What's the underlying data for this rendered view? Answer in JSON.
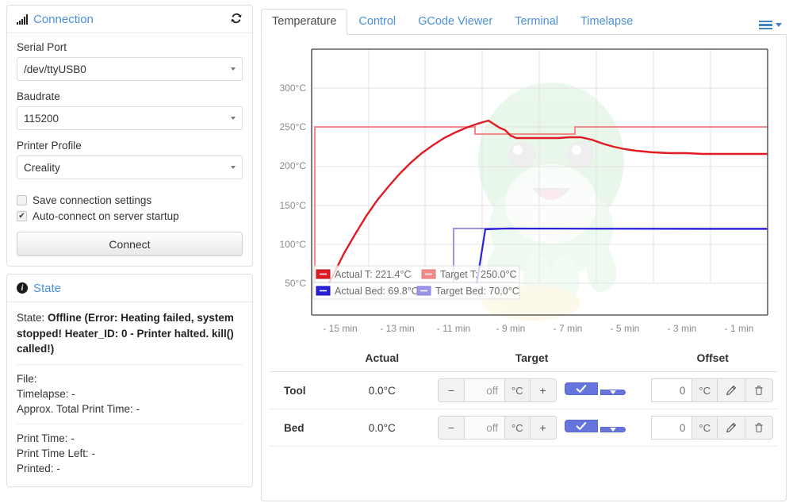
{
  "sidebar": {
    "connection": {
      "icon": "signal-bars-icon",
      "title": "Connection",
      "refresh_icon": "refresh-icon",
      "serial_port_label": "Serial Port",
      "serial_port_value": "/dev/ttyUSB0",
      "baudrate_label": "Baudrate",
      "baudrate_value": "115200",
      "printer_profile_label": "Printer Profile",
      "printer_profile_value": "Creality",
      "save_settings_label": "Save connection settings",
      "save_settings_checked": false,
      "autoconnect_label": "Auto-connect on server startup",
      "autoconnect_checked": true,
      "connect_button": "Connect"
    },
    "state": {
      "icon": "info-icon",
      "title": "State",
      "state_prefix": "State:",
      "state_value": "Offline (Error: Heating failed, system stopped! Heater_ID: 0 - Printer halted. kill() called!)",
      "file_line": "File:",
      "timelapse_line": "Timelapse: -",
      "approx_total_line": "Approx. Total Print Time: -",
      "print_time_line": "Print Time: -",
      "print_time_left_line": "Print Time Left: -",
      "printed_line": "Printed: -"
    }
  },
  "main": {
    "tabs": [
      {
        "label": "Temperature",
        "active": true
      },
      {
        "label": "Control",
        "active": false
      },
      {
        "label": "GCode Viewer",
        "active": false
      },
      {
        "label": "Terminal",
        "active": false
      },
      {
        "label": "Timelapse",
        "active": false
      }
    ],
    "menu_icon": "hamburger-menu-icon",
    "table": {
      "headers": [
        "",
        "Actual",
        "Target",
        "Offset"
      ],
      "rows": [
        {
          "name": "Tool",
          "actual": "0.0°C",
          "target_minus": "−",
          "target_value": "off",
          "target_unit": "°C",
          "target_plus": "+",
          "confirm_icon": "check-icon",
          "dropdown_icon": "caret-down-icon",
          "offset_value": "0",
          "offset_unit": "°C",
          "edit_icon": "pencil-icon",
          "delete_icon": "trash-icon"
        },
        {
          "name": "Bed",
          "actual": "0.0°C",
          "target_minus": "−",
          "target_value": "off",
          "target_unit": "°C",
          "target_plus": "+",
          "confirm_icon": "check-icon",
          "dropdown_icon": "caret-down-icon",
          "offset_value": "0",
          "offset_unit": "°C",
          "edit_icon": "pencil-icon",
          "delete_icon": "trash-icon"
        }
      ]
    }
  },
  "colors": {
    "actual_tool": "#e01b24",
    "target_tool": "#f58a8a",
    "actual_bed": "#2a21d8",
    "target_bed": "#9a95e8",
    "accent_blue": "#4a90d9",
    "primary_button": "#6674dd"
  },
  "chart_data": {
    "type": "line",
    "title": "",
    "xlabel": "",
    "ylabel": "",
    "xlim": [
      -16,
      0
    ],
    "ylim": [
      0,
      310
    ],
    "yticks": [
      50,
      100,
      150,
      200,
      250,
      300
    ],
    "ytick_labels": [
      "50°C",
      "100°C",
      "150°C",
      "200°C",
      "250°C",
      "300°C"
    ],
    "xticks": [
      -15,
      -13,
      -11,
      -9,
      -7,
      -5,
      -3,
      -1
    ],
    "xtick_labels": [
      "- 15 min",
      "- 13 min",
      "- 11 min",
      "- 9 min",
      "- 7 min",
      "- 5 min",
      "- 3 min",
      "- 1 min"
    ],
    "grid": true,
    "legend_position": "inside-bottom-left",
    "legend": [
      {
        "label": "Actual T: 221.4°C",
        "color": "#e01b24"
      },
      {
        "label": "Target T: 250.0°C",
        "color": "#f58a8a"
      },
      {
        "label": "Actual Bed: 69.8°C",
        "color": "#2a21d8"
      },
      {
        "label": "Target Bed: 70.0°C",
        "color": "#9a95e8"
      }
    ],
    "series": [
      {
        "name": "Actual T",
        "color": "#e01b24",
        "x": [
          -15.6,
          -15.4,
          -15.2,
          -15.0,
          -14.6,
          -14.2,
          -13.8,
          -13.4,
          -13.0,
          -12.6,
          -12.2,
          -11.8,
          -11.4,
          -11.0,
          -10.6,
          -10.2,
          -9.8,
          -9.4,
          -9.0,
          -8.7,
          -8.5,
          -8.3,
          -8.1,
          -7.9,
          -7.6,
          -7.2,
          -6.8,
          -6.4,
          -6.0,
          -5.6,
          -5.2,
          -4.8,
          -4.4,
          -4.0,
          -3.4,
          -2.8,
          -2.2,
          -1.6,
          -1.0,
          -0.4,
          0
        ],
        "y": [
          20,
          24,
          35,
          50,
          78,
          103,
          126,
          146,
          164,
          180,
          194,
          206,
          216,
          225,
          232,
          238,
          243,
          247,
          249,
          250,
          244,
          241,
          241,
          241,
          241,
          241,
          241,
          242,
          242,
          239,
          234,
          230,
          227,
          225,
          223,
          222,
          222,
          221.6,
          221.5,
          221.4,
          221.4
        ]
      },
      {
        "name": "Target T",
        "color": "#f58a8a",
        "x": [
          -15.6,
          -15.5,
          -15.5,
          -8.6,
          -8.6,
          -5.1,
          -5.1,
          0
        ],
        "y": [
          0,
          0,
          250,
          250,
          241,
          241,
          250,
          250
        ]
      },
      {
        "name": "Actual Bed",
        "color": "#2a21d8",
        "x": [
          -15.6,
          -9.3,
          -9.0,
          -8.6,
          -8.2,
          -7.8,
          -7.0,
          -5.0,
          -3.0,
          -1.0,
          0
        ],
        "y": [
          20,
          20,
          30,
          48,
          62,
          69,
          70,
          69.9,
          69.8,
          69.8,
          69.8
        ]
      },
      {
        "name": "Target Bed",
        "color": "#9a95e8",
        "x": [
          -15.6,
          -9.4,
          -9.4,
          0
        ],
        "y": [
          0,
          0,
          70,
          70
        ]
      }
    ]
  }
}
